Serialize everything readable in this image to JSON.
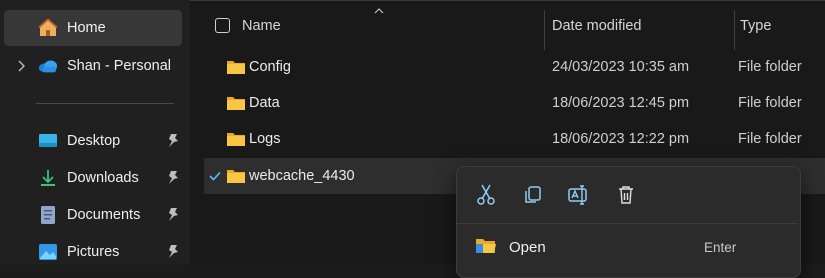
{
  "sidebar": {
    "home_label": "Home",
    "onedrive_label": "Shan - Personal",
    "quick_access": [
      {
        "label": "Desktop",
        "icon": "desktop-icon"
      },
      {
        "label": "Downloads",
        "icon": "downloads-icon"
      },
      {
        "label": "Documents",
        "icon": "documents-icon"
      },
      {
        "label": "Pictures",
        "icon": "pictures-icon"
      }
    ]
  },
  "columns": {
    "name": "Name",
    "date_modified": "Date modified",
    "type": "Type"
  },
  "files": [
    {
      "name": "Config",
      "date": "24/03/2023 10:35 am",
      "type": "File folder",
      "selected": false
    },
    {
      "name": "Data",
      "date": "18/06/2023 12:45 pm",
      "type": "File folder",
      "selected": false
    },
    {
      "name": "Logs",
      "date": "18/06/2023 12:22 pm",
      "type": "File folder",
      "selected": false
    },
    {
      "name": "webcache_4430",
      "date": "",
      "type": "",
      "selected": true
    }
  ],
  "context_menu": {
    "toolbar": [
      "cut-icon",
      "copy-icon",
      "rename-icon",
      "delete-icon"
    ],
    "items": [
      {
        "label": "Open",
        "shortcut": "Enter",
        "icon": "open-folder-icon"
      }
    ]
  },
  "colors": {
    "accent": "#4cc2ff",
    "folder": "#f8c642",
    "background": "#191919"
  }
}
